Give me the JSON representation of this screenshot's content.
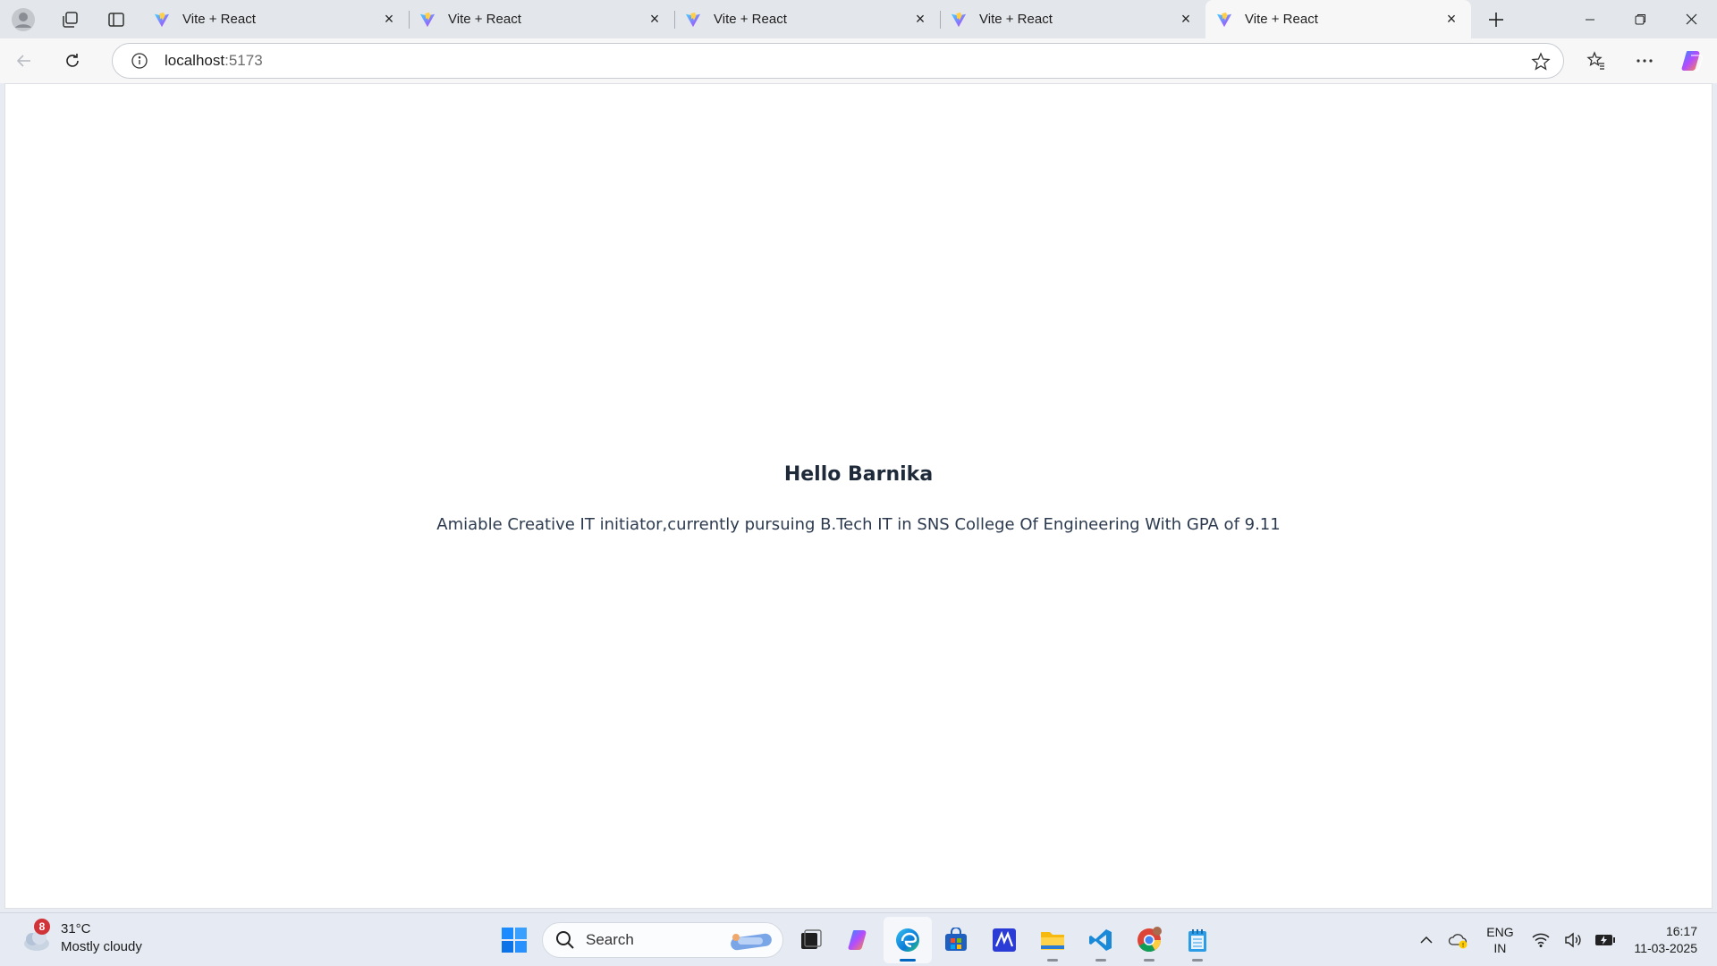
{
  "browser": {
    "tabs": [
      {
        "title": "Vite + React",
        "active": false
      },
      {
        "title": "Vite + React",
        "active": false
      },
      {
        "title": "Vite + React",
        "active": false
      },
      {
        "title": "Vite + React",
        "active": false
      },
      {
        "title": "Vite + React",
        "active": true
      }
    ],
    "address": {
      "host": "localhost",
      "port": ":5173"
    }
  },
  "page": {
    "heading": "Hello Barnika",
    "description": "Amiable Creative IT initiator,currently pursuing B.Tech IT in SNS College Of Engineering With GPA of 9.11"
  },
  "taskbar": {
    "weather": {
      "temp": "31°C",
      "condition": "Mostly cloudy",
      "badge": "8"
    },
    "search_label": "Search",
    "lang_top": "ENG",
    "lang_bottom": "IN",
    "time": "16:17",
    "date": "11-03-2025"
  },
  "colors": {
    "accent": "#0067c0",
    "page_bg": "#ffffff",
    "heading": "#1e2a3a"
  }
}
